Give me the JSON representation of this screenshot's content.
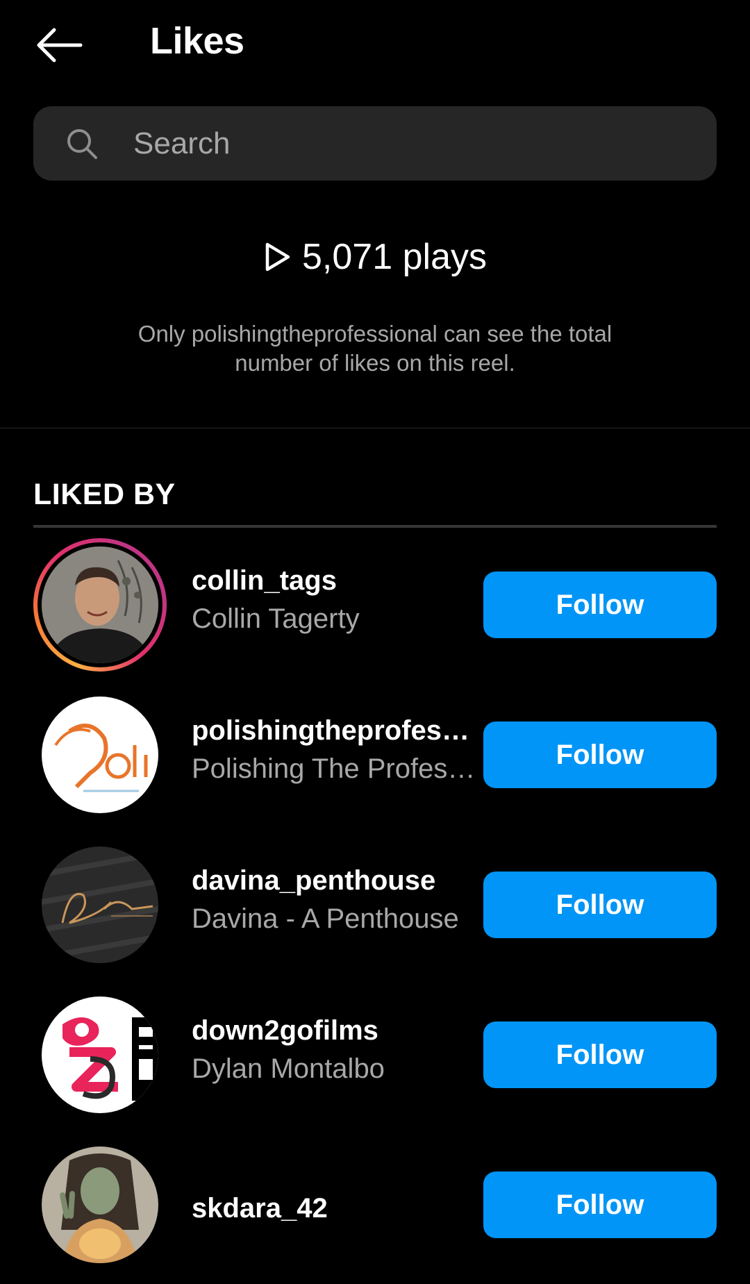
{
  "header": {
    "title": "Likes",
    "back_icon": "arrow-left-icon"
  },
  "search": {
    "placeholder": "Search",
    "icon": "search-icon"
  },
  "plays": {
    "icon": "play-icon",
    "text": "5,071 plays"
  },
  "notice": "Only polishingtheprofessional can see the total number of likes on this reel.",
  "section": {
    "title": "LIKED BY"
  },
  "users": [
    {
      "username": "collin_tags",
      "fullname": "Collin Tagerty",
      "button": "Follow",
      "has_story": true
    },
    {
      "username": "polishingtheprofessi…",
      "fullname": "Polishing The Profes…",
      "button": "Follow",
      "has_story": false
    },
    {
      "username": "davina_penthouse",
      "fullname": "Davina - A Penthouse",
      "button": "Follow",
      "has_story": false
    },
    {
      "username": "down2gofilms",
      "fullname": "Dylan Montalbo",
      "button": "Follow",
      "has_story": false
    },
    {
      "username": "skdara_42",
      "fullname": "",
      "button": "Follow",
      "has_story": false
    }
  ],
  "colors": {
    "background": "#000000",
    "accent": "#0095f6",
    "secondary_text": "#a8a8a8",
    "search_bg": "#262626"
  }
}
